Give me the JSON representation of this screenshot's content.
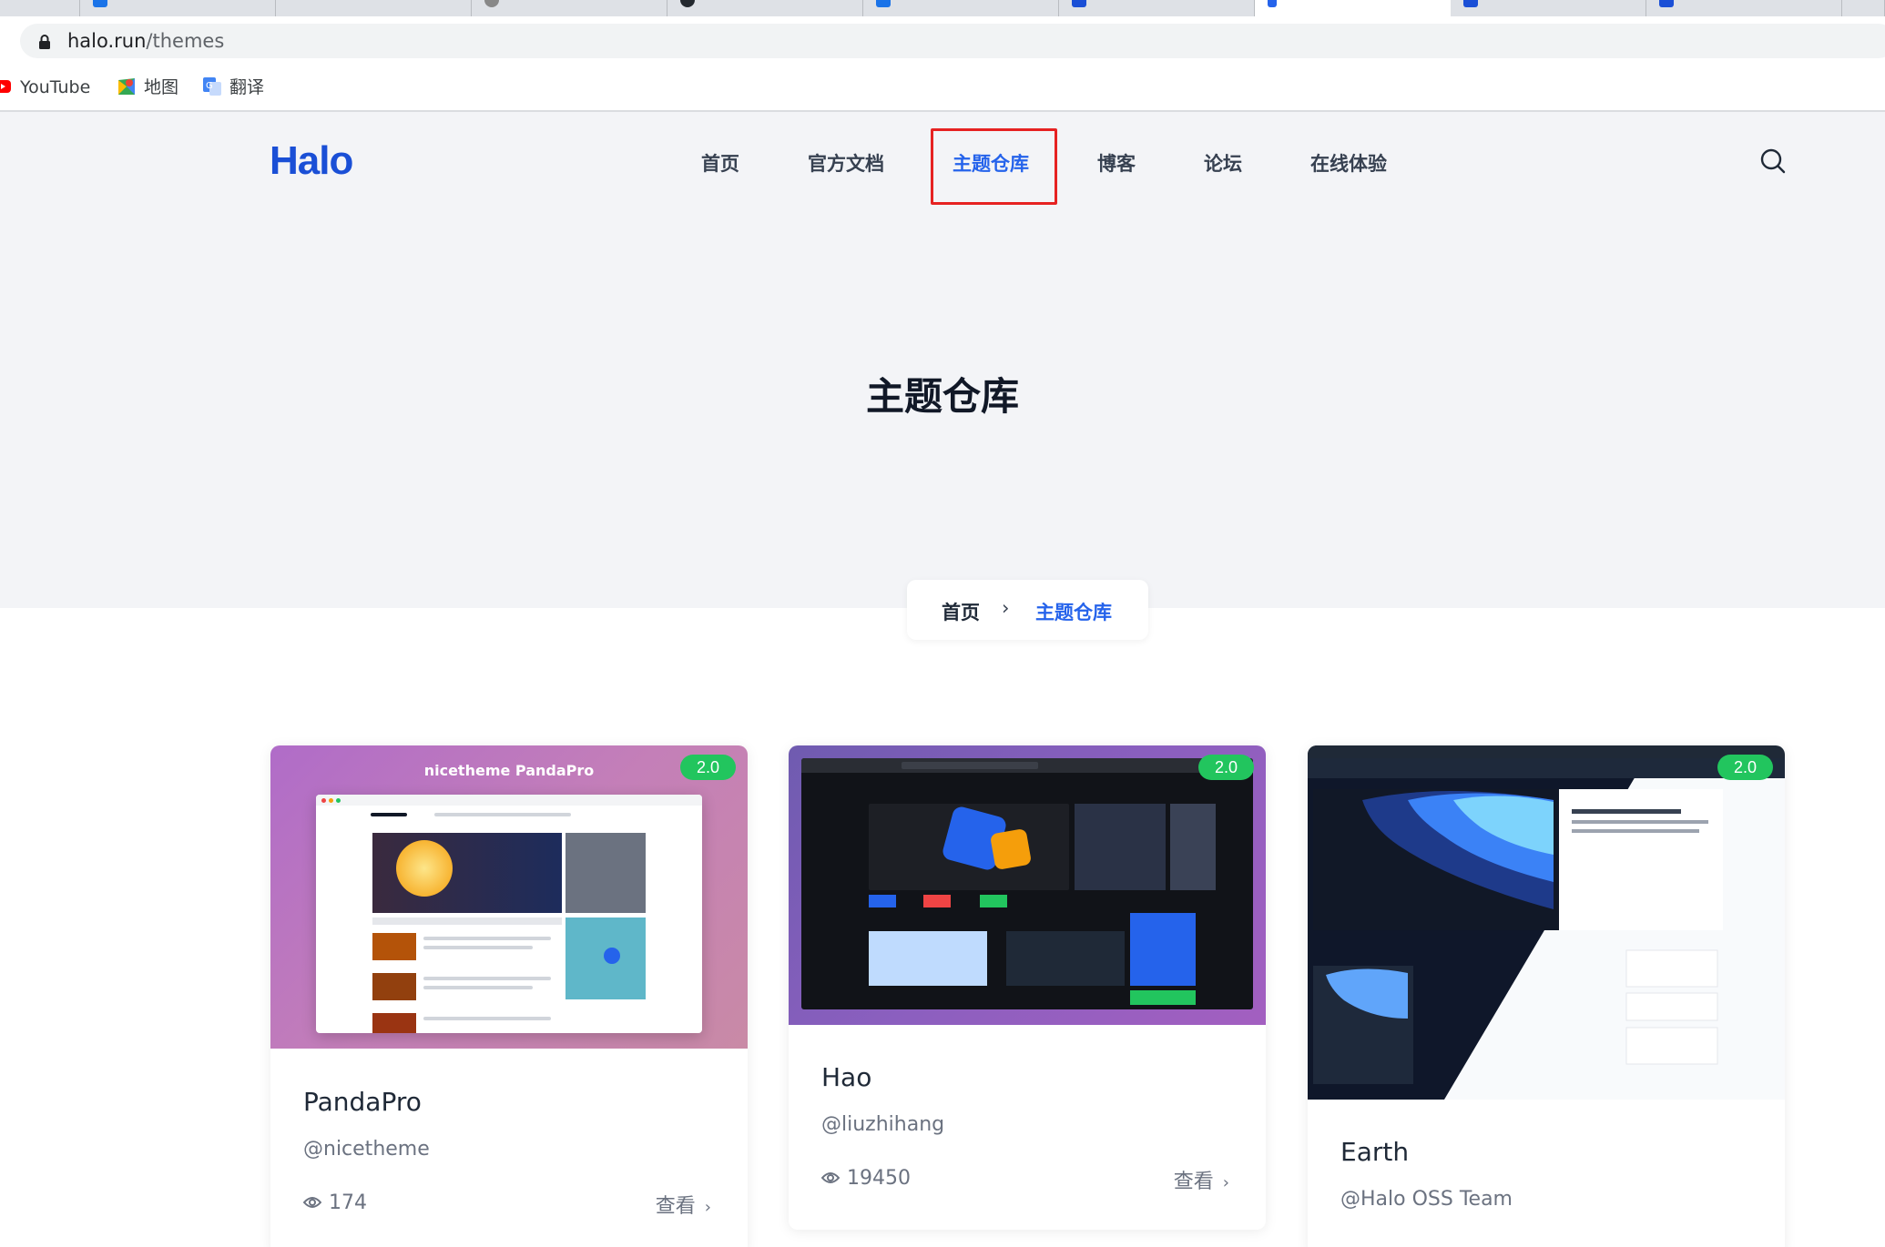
{
  "browser": {
    "url_host": "halo.run",
    "url_path": "/themes"
  },
  "bookmarks": [
    {
      "label": "YouTube",
      "icon": "youtube-icon"
    },
    {
      "label": "地图",
      "icon": "maps-icon"
    },
    {
      "label": "翻译",
      "icon": "translate-icon"
    }
  ],
  "site": {
    "logo": "Halo",
    "nav": [
      "首页",
      "官方文档",
      "主题仓库",
      "博客",
      "论坛",
      "在线体验"
    ],
    "current_nav": "主题仓库"
  },
  "page": {
    "title": "主题仓库",
    "breadcrumb": {
      "home": "首页",
      "separator": "›",
      "current": "主题仓库"
    }
  },
  "themes": [
    {
      "name": "PandaPro",
      "author": "@nicetheme",
      "views": "174",
      "version": "2.0",
      "link": "查看",
      "thumb_title": "nicetheme PandaPro"
    },
    {
      "name": "Hao",
      "author": "@liuzhihang",
      "views": "19450",
      "version": "2.0",
      "link": "查看"
    },
    {
      "name": "Earth",
      "author": "@Halo OSS Team",
      "version": "2.0"
    }
  ],
  "colors": {
    "brand": "#1a4fd6",
    "accent": "#2563eb",
    "badge": "#22c55e",
    "highlight": "#e62222"
  }
}
